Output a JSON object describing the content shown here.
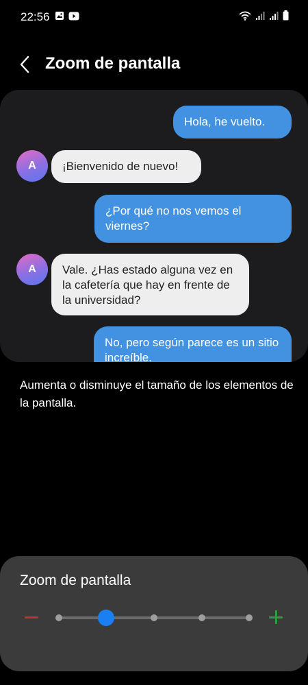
{
  "status_bar": {
    "time": "22:56",
    "left_icons": [
      "gallery-icon",
      "youtube-icon"
    ],
    "right_icons": [
      "wifi-icon",
      "signal-icon",
      "signal-icon",
      "battery-icon"
    ]
  },
  "header": {
    "back_icon": "chevron-left-icon",
    "title": "Zoom de pantalla"
  },
  "preview": {
    "avatar_letter": "A",
    "messages": [
      {
        "side": "out",
        "text": "Hola, he vuelto."
      },
      {
        "side": "in",
        "text": "¡Bienvenido de nuevo!"
      },
      {
        "side": "out",
        "text": "¿Por qué no nos vemos el viernes?"
      },
      {
        "side": "in",
        "text": "Vale. ¿Has estado alguna vez en la cafetería que hay en frente de la universidad?"
      },
      {
        "side": "out",
        "text": "No, pero según parece es un sitio increíble."
      }
    ]
  },
  "description": "Aumenta o disminuye el tamaño de los elementos de la pantalla.",
  "zoom_sheet": {
    "title": "Zoom de pantalla",
    "level_index": 1,
    "level_count": 5,
    "colors": {
      "minus": "#c0312b",
      "plus": "#2d9b3f",
      "thumb": "#1a7ff0"
    }
  }
}
